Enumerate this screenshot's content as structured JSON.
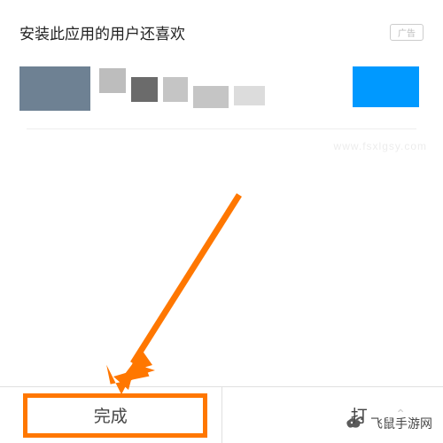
{
  "section": {
    "title": "安装此应用的用户还喜欢",
    "ad_label": "广告"
  },
  "bottom_bar": {
    "complete_label": "完成",
    "open_label": "打"
  },
  "watermark": {
    "text": "飞鼠手游网",
    "faint": "www.fsxlgsy.com"
  },
  "highlight": {
    "color": "#ff7700"
  }
}
